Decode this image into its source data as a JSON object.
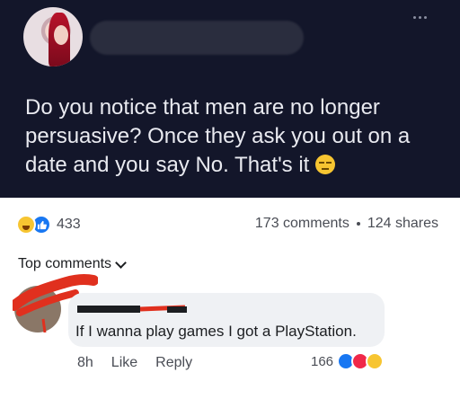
{
  "post": {
    "text": "Do you notice that men are no longer persuasive? Once they ask you out on a date and you say No. That's it",
    "emoji": "expressionless-face-emoji"
  },
  "reactions": {
    "count": "433",
    "icons": [
      "haha-icon",
      "like-icon"
    ]
  },
  "stats": {
    "comments": "173 comments",
    "shares": "124 shares"
  },
  "top_comments_label": "Top comments",
  "comment": {
    "text": "If I wanna play games I got a PlayStation.",
    "time": "8h",
    "like_label": "Like",
    "reply_label": "Reply",
    "reaction_count": "166",
    "reaction_icons": [
      "like-icon",
      "love-icon",
      "haha-icon"
    ]
  },
  "colors": {
    "post_bg": "#13162a",
    "like_blue": "#1877f2",
    "love_red": "#f02849",
    "haha_yellow": "#f7c531",
    "redact_red": "#e0301e"
  }
}
